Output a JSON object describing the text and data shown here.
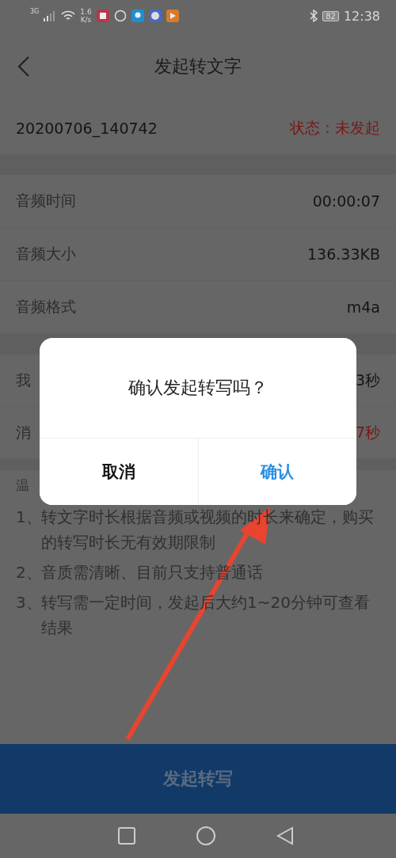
{
  "status_bar": {
    "network": "3G",
    "speed": [
      "1.6",
      "K/s"
    ],
    "battery": "82",
    "time": "12:38"
  },
  "header": {
    "title": "发起转文字"
  },
  "file": {
    "name": "20200706_140742",
    "status": "状态：未发起"
  },
  "audio_rows": [
    {
      "label": "音频时间",
      "value": "00:00:07"
    },
    {
      "label": "音频大小",
      "value": "136.33KB"
    },
    {
      "label": "音频格式",
      "value": "m4a"
    }
  ],
  "usage_rows": [
    {
      "label": "我",
      "value": "3秒",
      "highlight": false
    },
    {
      "label": "消",
      "value": "7秒",
      "highlight": true
    }
  ],
  "tips": {
    "title": "温",
    "items": [
      {
        "number": "1、",
        "text": "转文字时长根据音频或视频的时长来确定，购买的转写时长无有效期限制"
      },
      {
        "number": "2、",
        "text": "音质需清晰、目前只支持普通话"
      },
      {
        "number": "3、",
        "text": "转写需一定时间，发起后大约1~20分钟可查看结果"
      }
    ]
  },
  "submit_button": {
    "label": "发起转写"
  },
  "dialog": {
    "message": "确认发起转写吗？",
    "buttons": [
      {
        "label": "取消",
        "primary": false
      },
      {
        "label": "确认",
        "primary": true
      }
    ]
  }
}
